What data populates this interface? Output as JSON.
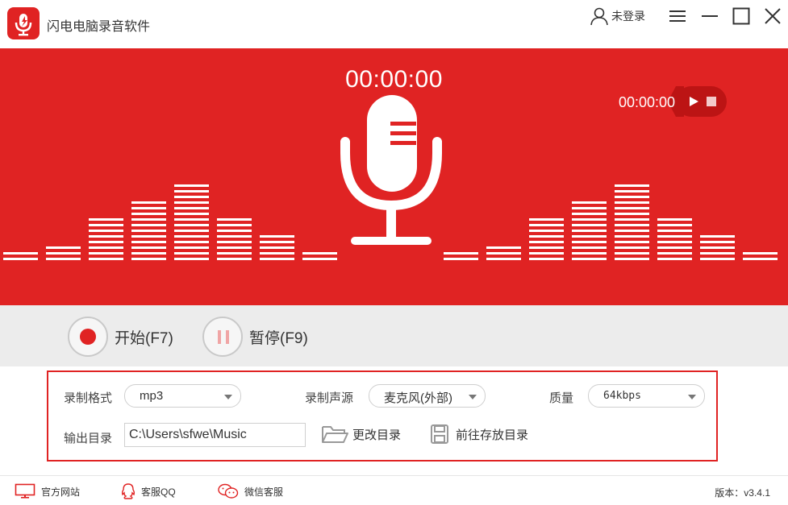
{
  "app": {
    "title": "闪电电脑录音软件",
    "login_label": "未登录"
  },
  "recording": {
    "timer": "00:00:00",
    "playback_timer": "00:00:00"
  },
  "controls": {
    "start_label": "开始(F7)",
    "pause_label": "暂停(F9)"
  },
  "settings": {
    "format_label": "录制格式",
    "format_value": "mp3",
    "source_label": "录制声源",
    "source_value": "麦克风(外部)",
    "quality_label": "质量",
    "quality_value": "64kbps",
    "output_label": "输出目录",
    "output_path": "C:\\Users\\sfwe\\Music",
    "change_dir_label": "更改目录",
    "open_dir_label": "前往存放目录"
  },
  "footer": {
    "website_label": "官方网站",
    "qq_label": "客服QQ",
    "wechat_label": "微信客服",
    "version": "版本：v3.4.1"
  },
  "colors": {
    "brand_red": "#e02323",
    "dark_red": "#bc1414",
    "band_gray": "#ececec"
  },
  "icons": [
    "mic-logo-icon",
    "user-icon",
    "menu-icon",
    "minimize-icon",
    "maximize-icon",
    "close-icon",
    "microphone-icon",
    "play-icon",
    "stop-icon",
    "record-icon",
    "pause-icon",
    "folder-icon",
    "save-icon",
    "monitor-icon",
    "qq-icon",
    "wechat-icon"
  ]
}
